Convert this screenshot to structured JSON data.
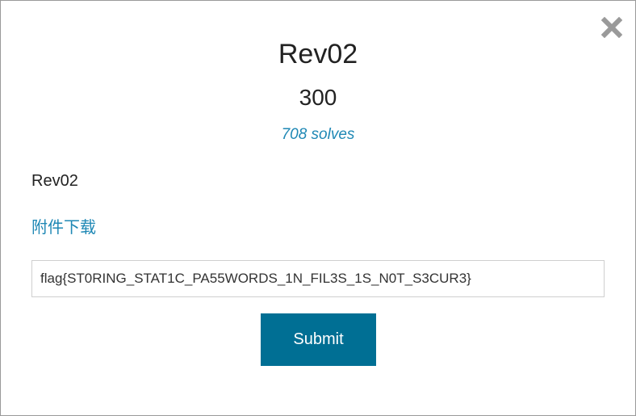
{
  "challenge": {
    "name": "Rev02",
    "points": "300",
    "solves": "708 solves",
    "description": "Rev02",
    "attachment_label": "附件下载"
  },
  "form": {
    "flag_value": "flag{ST0RING_STAT1C_PA55WORDS_1N_FIL3S_1S_N0T_S3CUR3}",
    "submit_label": "Submit"
  },
  "icons": {
    "close": "close-icon"
  },
  "colors": {
    "accent_link": "#1f88b5",
    "submit_bg": "#006f94",
    "close_icon": "#9a9a9a"
  }
}
